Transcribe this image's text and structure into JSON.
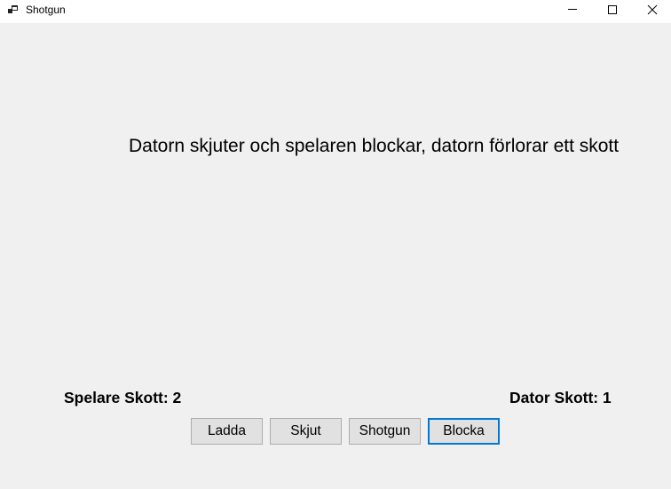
{
  "window": {
    "title": "Shotgun",
    "icon": "app-window-icon",
    "controls": [
      "minimize-icon",
      "maximize-icon",
      "close-icon"
    ]
  },
  "main": {
    "message": "Datorn skjuter och spelaren blockar, datorn förlorar ett skott",
    "player_score": "Spelare Skott: 2",
    "computer_score": "Dator Skott: 1"
  },
  "actions": {
    "load_label": "Ladda",
    "shoot_label": "Skjut",
    "shotgun_label": "Shotgun",
    "block_label": "Blocka",
    "focused": "Blocka"
  },
  "colors": {
    "background": "#f0f0f0",
    "titlebar": "#ffffff",
    "button_face": "#e1e1e1",
    "button_border": "#adadad",
    "focus_border": "#0078d7"
  }
}
